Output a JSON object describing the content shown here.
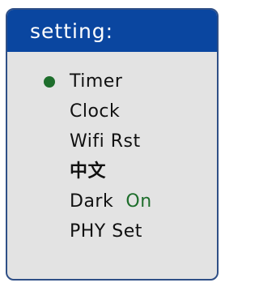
{
  "header": {
    "title": "setting:"
  },
  "menu": {
    "items": [
      {
        "label": "Timer",
        "selected": true
      },
      {
        "label": "Clock"
      },
      {
        "label": "Wifi Rst"
      },
      {
        "label": "中文"
      },
      {
        "label": "Dark",
        "state": "On"
      },
      {
        "label": "PHY Set"
      }
    ]
  },
  "colors": {
    "header_bg": "#0a46a0",
    "panel_bg": "#e3e3e3",
    "accent_green": "#1e6e2c",
    "border": "#2f4f86"
  }
}
